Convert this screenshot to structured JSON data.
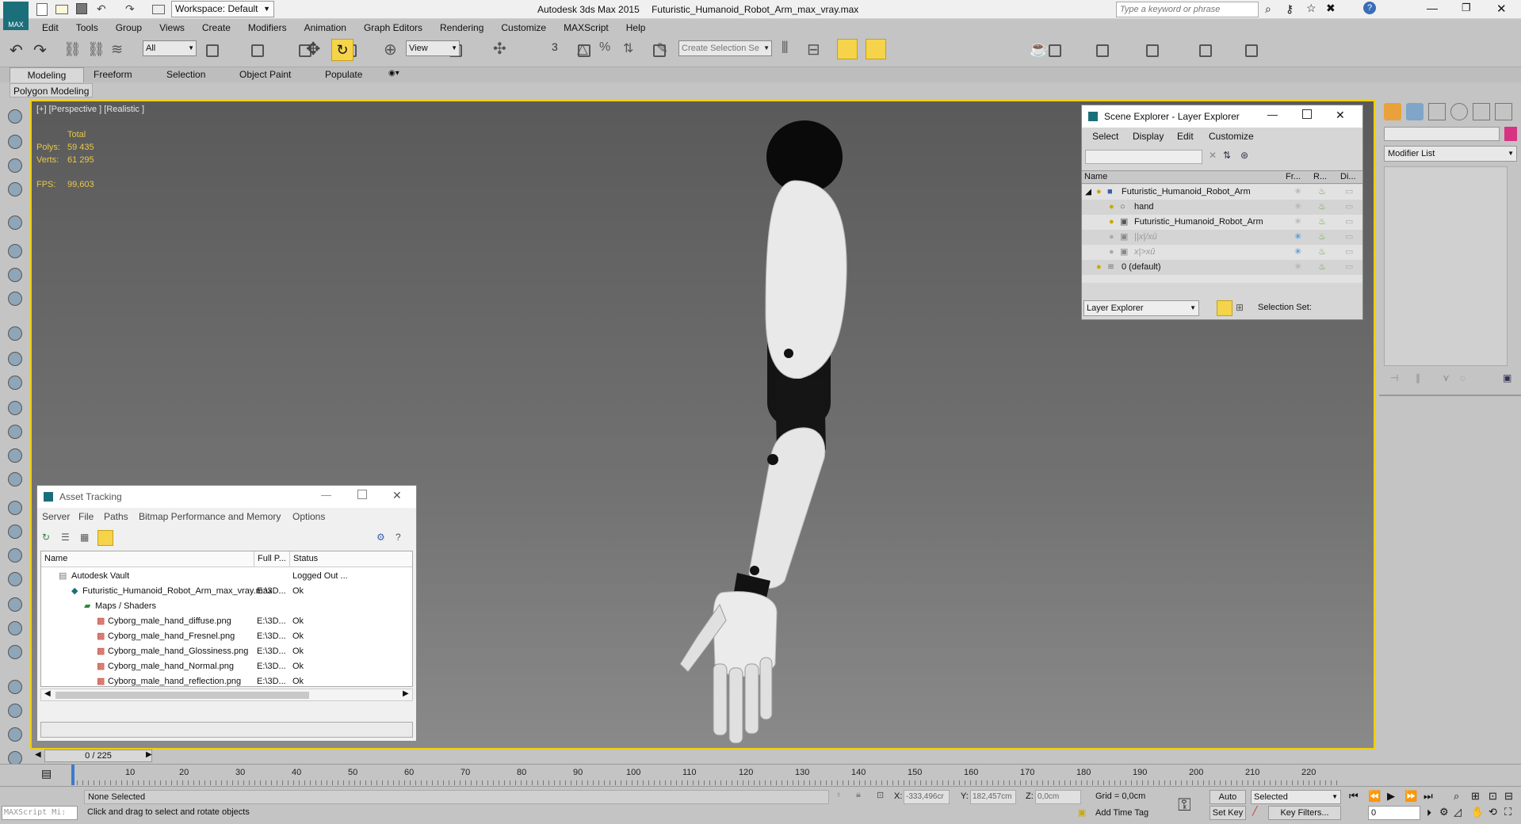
{
  "window": {
    "app": "Autodesk 3ds Max  2015",
    "file": "Futuristic_Humanoid_Robot_Arm_max_vray.max",
    "workspace": "Workspace: Default",
    "search_placeholder": "Type a keyword or phrase",
    "logo": "MAX"
  },
  "menu": [
    "Edit",
    "Tools",
    "Group",
    "Views",
    "Create",
    "Modifiers",
    "Animation",
    "Graph Editors",
    "Rendering",
    "Customize",
    "MAXScript",
    "Help"
  ],
  "toolbar": {
    "filter": "All",
    "ref_coord": "View",
    "selection_set": "Create Selection Se",
    "snap_angle": "3"
  },
  "ribbon": {
    "tabs": [
      "Modeling",
      "Freeform",
      "Selection",
      "Object Paint",
      "Populate"
    ],
    "subtitle": "Polygon Modeling"
  },
  "viewport": {
    "label": "[+] [Perspective ] [Realistic ]",
    "stats": {
      "total": "Total",
      "polys_label": "Polys:",
      "polys": "59 435",
      "verts_label": "Verts:",
      "verts": "61 295",
      "fps_label": "FPS:",
      "fps": "99,603"
    }
  },
  "scene_explorer": {
    "title": "Scene Explorer - Layer Explorer",
    "menu": [
      "Select",
      "Display",
      "Edit",
      "Customize"
    ],
    "columns": [
      "Name",
      "Fr...",
      "R...",
      "Di..."
    ],
    "rows": [
      {
        "name": "Futuristic_Humanoid_Robot_Arm",
        "indent": 0,
        "style": "normal"
      },
      {
        "name": "hand",
        "indent": 1,
        "style": "normal"
      },
      {
        "name": "Futuristic_Humanoid_Robot_Arm",
        "indent": 1,
        "style": "normal"
      },
      {
        "name": "||x|/xû",
        "indent": 1,
        "style": "dim"
      },
      {
        "name": "x|>xû",
        "indent": 1,
        "style": "dim"
      },
      {
        "name": "0 (default)",
        "indent": 0,
        "style": "normal"
      }
    ],
    "footer_select": "Layer Explorer",
    "selection_set_label": "Selection Set:"
  },
  "command_panel": {
    "modifier_list": "Modifier List"
  },
  "asset_tracking": {
    "title": "Asset Tracking",
    "menu": [
      "Server",
      "File",
      "Paths",
      "Bitmap Performance and Memory",
      "Options"
    ],
    "columns": [
      "Name",
      "Full P...",
      "Status"
    ],
    "rows": [
      {
        "name": "Autodesk Vault",
        "path": "",
        "status": "Logged Out ...",
        "indent": 1
      },
      {
        "name": "Futuristic_Humanoid_Robot_Arm_max_vray.max",
        "path": "E:\\3D...",
        "status": "Ok",
        "indent": 2
      },
      {
        "name": "Maps / Shaders",
        "path": "",
        "status": "",
        "indent": 3
      },
      {
        "name": "Cyborg_male_hand_diffuse.png",
        "path": "E:\\3D...",
        "status": "Ok",
        "indent": 4
      },
      {
        "name": "Cyborg_male_hand_Fresnel.png",
        "path": "E:\\3D...",
        "status": "Ok",
        "indent": 4
      },
      {
        "name": "Cyborg_male_hand_Glossiness.png",
        "path": "E:\\3D...",
        "status": "Ok",
        "indent": 4
      },
      {
        "name": "Cyborg_male_hand_Normal.png",
        "path": "E:\\3D...",
        "status": "Ok",
        "indent": 4
      },
      {
        "name": "Cyborg_male_hand_reflection.png",
        "path": "E:\\3D...",
        "status": "Ok",
        "indent": 4
      }
    ]
  },
  "timeline": {
    "frame": "0 / 225",
    "ticks": [
      "10",
      "20",
      "30",
      "40",
      "50",
      "60",
      "70",
      "80",
      "90",
      "100",
      "110",
      "120",
      "130",
      "140",
      "150",
      "160",
      "170",
      "180",
      "190",
      "200",
      "210",
      "220"
    ]
  },
  "status": {
    "maxscript": "MAXScript Mi:",
    "selection": "None Selected",
    "prompt": "Click and drag to select and rotate objects",
    "x_label": "X:",
    "x": "-333,496cr",
    "y_label": "Y:",
    "y": "182,457cm",
    "z_label": "Z:",
    "z": "0,0cm",
    "grid": "Grid = 0,0cm",
    "add_time_tag": "Add Time Tag",
    "auto_key": "Auto Key",
    "set_key": "Set Key",
    "key_mode": "Selected",
    "key_filters": "Key Filters...",
    "frame_value": "0"
  }
}
